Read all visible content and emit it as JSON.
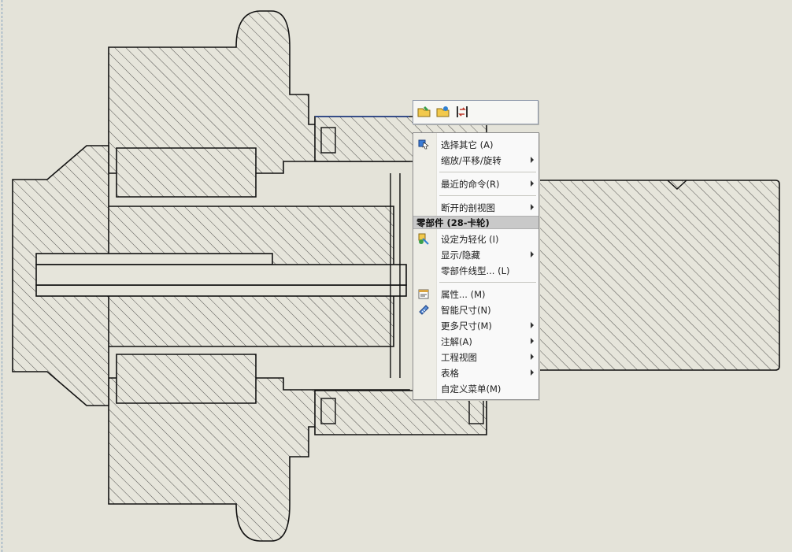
{
  "toolbar": {
    "buttons": [
      {
        "icon": "open-part-icon"
      },
      {
        "icon": "open-assembly-icon"
      },
      {
        "icon": "swap-icon"
      }
    ]
  },
  "context_menu": {
    "items_top": [
      {
        "label": "选择其它 (A)",
        "icon": "select-other-icon",
        "submenu": false
      },
      {
        "label": "缩放/平移/旋转",
        "submenu": true
      },
      {
        "label": "最近的命令(R)",
        "submenu": true
      },
      {
        "label": "断开的剖视图",
        "submenu": true
      }
    ],
    "section_header": "零部件 (28-卡轮)",
    "items_component": [
      {
        "label": "设定为轻化 (I)",
        "icon": "lightweight-icon",
        "submenu": false
      },
      {
        "label": "显示/隐藏",
        "submenu": true
      },
      {
        "label": "零部件线型... (L)",
        "submenu": false
      }
    ],
    "items_bottom": [
      {
        "label": "属性... (M)",
        "icon": "properties-icon",
        "submenu": false
      },
      {
        "label": "智能尺寸(N)",
        "icon": "smart-dimension-icon",
        "submenu": false
      },
      {
        "label": "更多尺寸(M)",
        "submenu": true
      },
      {
        "label": "注解(A)",
        "submenu": true
      },
      {
        "label": "工程视图",
        "submenu": true
      },
      {
        "label": "表格",
        "submenu": true
      },
      {
        "label": "自定义菜单(M)",
        "submenu": false
      }
    ]
  },
  "colors": {
    "background": "#e4e3d9",
    "line": "#111111",
    "highlight": "#1f3f8f"
  }
}
